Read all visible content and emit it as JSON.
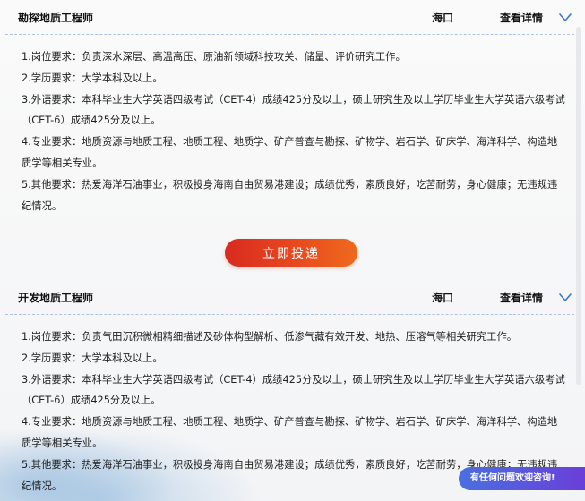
{
  "jobs": [
    {
      "title": "勘探地质工程师",
      "location": "海口",
      "detail_label": "查看详情",
      "requirements": [
        "1.岗位要求：负责深水深层、高温高压、原油新领域科技攻关、储量、评价研究工作。",
        "2.学历要求：大学本科及以上。",
        "3.外语要求：本科毕业生大学英语四级考试（CET-4）成绩425分及以上，硕士研究生及以上学历毕业生大学英语六级考试（CET-6）成绩425分及以上。",
        "4.专业要求：地质资源与地质工程、地质工程、地质学、矿产普查与勘探、矿物学、岩石学、矿床学、海洋科学、构造地质学等相关专业。",
        "5.其他要求：热爱海洋石油事业，积极投身海南自由贸易港建设；成绩优秀，素质良好，吃苦耐劳，身心健康；无违规违纪情况。"
      ]
    },
    {
      "title": "开发地质工程师",
      "location": "海口",
      "detail_label": "查看详情",
      "requirements": [
        "1.岗位要求：负责气田沉积微相精细描述及砂体构型解析、低渗气藏有效开发、地热、压溶气等相关研究工作。",
        "2.学历要求：大学本科及以上。",
        "3.外语要求：本科毕业生大学英语四级考试（CET-4）成绩425分及以上，硕士研究生及以上学历毕业生大学英语六级考试（CET-6）成绩425分及以上。",
        "4.专业要求：地质资源与地质工程、地质工程、地质学、矿产普查与勘探、矿物学、岩石学、矿床学、海洋科学、构造地质学等相关专业。",
        "5.其他要求：热爱海洋石油事业，积极投身海南自由贸易港建设；成绩优秀，素质良好，吃苦耐劳，身心健康；无违规违纪情况。"
      ]
    }
  ],
  "apply_label": "立即投递",
  "consult_label": "有任何问题欢迎咨询!",
  "colors": {
    "accent_start": "#d92a20",
    "accent_end": "#ef6a1c",
    "chevron": "#3a78c9",
    "consult_start": "#4a6fe0",
    "consult_end": "#6a3fd8"
  },
  "icons": {
    "expand": "chevron-down-icon"
  }
}
